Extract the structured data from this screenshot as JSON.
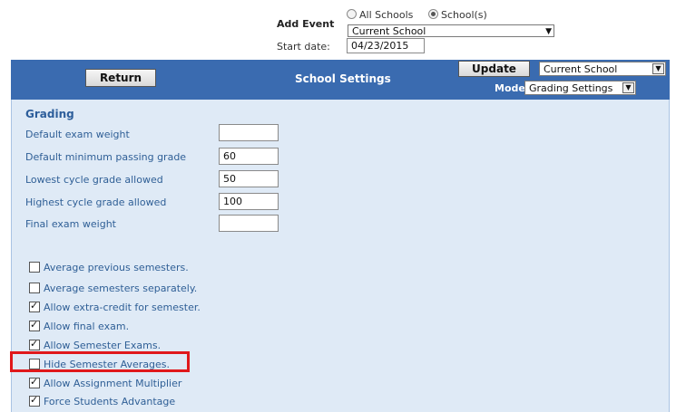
{
  "add_event": {
    "label": "Add Event",
    "radio_all_schools": "All Schools",
    "radio_schools": "School(s)",
    "school_select": "Current School",
    "start_date_label": "Start date:",
    "start_date_value": "04/23/2015"
  },
  "header": {
    "return_label": "Return",
    "title": "School Settings",
    "update_label": "Update",
    "school_select": "Current School",
    "mode_label": "Mode",
    "mode_select": "Grading Settings"
  },
  "grading": {
    "section_title": "Grading",
    "fields": [
      {
        "label": "Default exam weight",
        "value": ""
      },
      {
        "label": "Default minimum passing grade",
        "value": "60"
      },
      {
        "label": "Lowest cycle grade allowed",
        "value": "50"
      },
      {
        "label": "Highest cycle grade allowed",
        "value": "100"
      },
      {
        "label": "Final exam weight",
        "value": ""
      }
    ],
    "checkboxes": [
      {
        "label": "Average previous semesters.",
        "checked": false
      },
      {
        "label": "Average semesters separately.",
        "checked": false
      },
      {
        "label": "Allow extra-credit for semester.",
        "checked": true
      },
      {
        "label": "Allow final exam.",
        "checked": true
      },
      {
        "label": "Allow Semester Exams.",
        "checked": true
      },
      {
        "label": "Hide Semester Averages.",
        "checked": false
      },
      {
        "label": "Allow Assignment Multiplier",
        "checked": true
      },
      {
        "label": "Force Students Advantage",
        "checked": true
      }
    ]
  },
  "colors": {
    "bar": "#3a6bb0",
    "panel": "#dfeaf6",
    "highlight": "#e0181b"
  }
}
